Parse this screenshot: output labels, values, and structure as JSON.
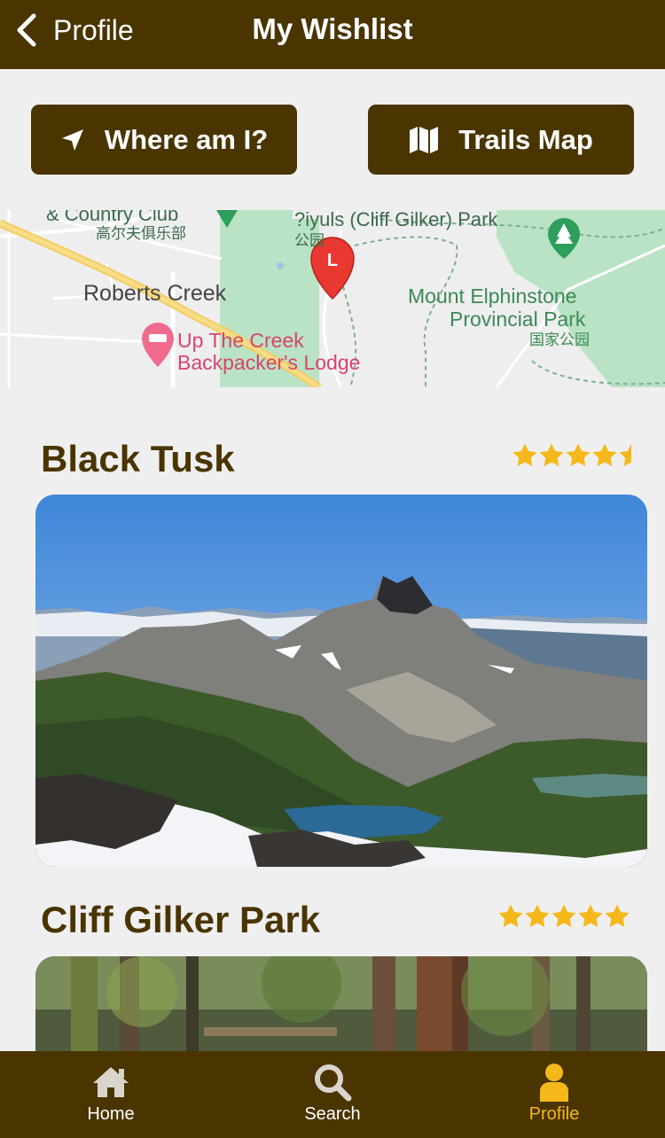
{
  "navbar": {
    "back_label": "Profile",
    "title": "My Wishlist"
  },
  "actions": {
    "where_label": "Where am I?",
    "trails_map_label": "Trails Map"
  },
  "map": {
    "labels": {
      "country_club": "& Country Club",
      "country_club_cn": "高尔夫俱乐部",
      "park": "?iyuls (Cliff Gilker) Park",
      "park_cn": "公园",
      "roberts_creek": "Roberts Creek",
      "lodge_line1": "Up The Creek",
      "lodge_line2": "Backpacker's Lodge",
      "elphinstone_line1": "Mount Elphinstone",
      "elphinstone_line2": "Provincial Park",
      "elphinstone_cn": "国家公园",
      "pin_letter": "L"
    }
  },
  "trails": [
    {
      "name": "Black Tusk",
      "rating": 4.5
    },
    {
      "name": "Cliff Gilker Park",
      "rating": 5
    }
  ],
  "tabs": [
    {
      "label": "Home",
      "icon": "home-icon",
      "active": false
    },
    {
      "label": "Search",
      "icon": "search-icon",
      "active": false
    },
    {
      "label": "Profile",
      "icon": "profile-icon",
      "active": true
    }
  ],
  "colors": {
    "brand": "#4a3500",
    "star": "#f5b81a",
    "background": "#f0eff0"
  }
}
